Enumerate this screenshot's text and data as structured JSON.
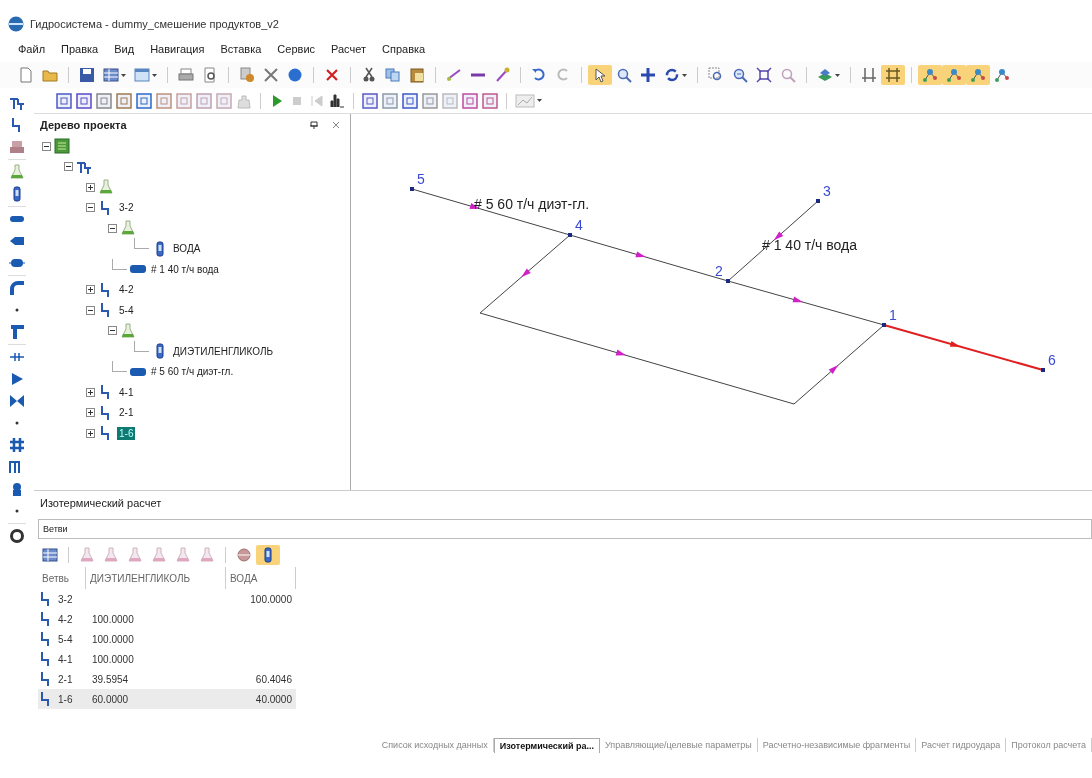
{
  "window": {
    "title": "Гидросистема - dummy_смешение продуктов_v2"
  },
  "menu": [
    "Файл",
    "Правка",
    "Вид",
    "Навигация",
    "Вставка",
    "Сервис",
    "Расчет",
    "Справка"
  ],
  "main_toolbar": [
    {
      "on": false
    },
    {
      "on": false
    },
    {
      "on": false
    },
    {
      "on": false
    },
    {
      "on": false
    },
    {
      "on": false
    },
    {
      "on": false
    },
    {
      "on": false
    },
    {
      "on": false
    },
    {
      "on": false
    },
    {
      "on": false
    },
    {
      "on": false
    },
    {
      "on": false
    },
    {
      "on": false
    },
    {
      "on": false
    },
    {
      "on": false
    },
    {
      "on": false
    },
    {
      "on": false
    },
    {
      "on": false
    },
    {
      "on": true
    },
    {
      "on": false
    },
    {
      "on": false
    },
    {
      "on": false
    },
    {
      "on": false
    },
    {
      "on": false
    },
    {
      "on": false
    },
    {
      "on": false
    },
    {
      "on": false
    },
    {
      "on": false
    },
    {
      "on": true
    },
    {
      "on": true
    },
    {
      "on": true
    },
    {
      "on": true
    },
    {
      "on": false
    }
  ],
  "project_tree": {
    "title": "Дерево проекта",
    "items": [
      {
        "kind": "project",
        "expanded": true,
        "selected": false,
        "children": [
          {
            "kind": "network",
            "expanded": true,
            "selected": false,
            "children": [
              {
                "kind": "flask",
                "expanded": false,
                "selected": false
              },
              {
                "kind": "branch",
                "label": "3-2",
                "expanded": true,
                "selected": false,
                "children": [
                  {
                    "kind": "flask",
                    "expanded": true,
                    "selected": false,
                    "children": [
                      {
                        "kind": "bottle",
                        "label": "ВОДА",
                        "selected": false
                      }
                    ]
                  },
                  {
                    "kind": "flow",
                    "label": "# 1 40 т/ч вода",
                    "selected": false
                  }
                ]
              },
              {
                "kind": "branch",
                "label": "4-2",
                "expanded": false,
                "selected": false
              },
              {
                "kind": "branch",
                "label": "5-4",
                "expanded": true,
                "selected": false,
                "children": [
                  {
                    "kind": "flask",
                    "expanded": true,
                    "selected": false,
                    "children": [
                      {
                        "kind": "bottle",
                        "label": "ДИЭТИЛЕНГЛИКОЛЬ",
                        "selected": false
                      }
                    ]
                  },
                  {
                    "kind": "flow",
                    "label": "# 5 60 т/ч диэт-гл.",
                    "selected": false
                  }
                ]
              },
              {
                "kind": "branch",
                "label": "4-1",
                "expanded": false,
                "selected": false
              },
              {
                "kind": "branch",
                "label": "2-1",
                "expanded": false,
                "selected": false
              },
              {
                "kind": "branch",
                "label": "1-6",
                "expanded": false,
                "selected": true
              }
            ]
          }
        ]
      }
    ]
  },
  "diagram": {
    "nodes": [
      "5",
      "4",
      "2",
      "1",
      "6",
      "3"
    ],
    "labels": [
      "# 5 60 т/ч диэт-гл.",
      "# 1 40 т/ч вода"
    ],
    "pipes": [
      {
        "selected": false
      },
      {
        "selected": false
      },
      {
        "selected": false
      },
      {
        "selected": false
      },
      {
        "selected": false
      },
      {
        "selected": true
      }
    ]
  },
  "calc_panel": {
    "title": "Изотермический расчет",
    "view": "Ветви",
    "toolbar": [
      {
        "on": false
      },
      {
        "on": false
      },
      {
        "on": false
      },
      {
        "on": false
      },
      {
        "on": false
      },
      {
        "on": false
      },
      {
        "on": false
      },
      {
        "on": false
      },
      {
        "on": true
      }
    ],
    "columns": [
      "Ветвь",
      "ДИЭТИЛЕНГЛИКОЛЬ",
      "ВОДА"
    ],
    "rows": [
      {
        "branch": "3-2",
        "water": "100.0000",
        "selected": false
      },
      {
        "branch": "4-2",
        "glycol": "100.0000",
        "selected": false
      },
      {
        "branch": "5-4",
        "glycol": "100.0000",
        "selected": false
      },
      {
        "branch": "4-1",
        "glycol": "100.0000",
        "selected": false
      },
      {
        "branch": "2-1",
        "glycol": "39.5954",
        "water": "60.4046",
        "selected": false
      },
      {
        "branch": "1-6",
        "glycol": "60.0000",
        "water": "40.0000",
        "selected": true
      }
    ]
  },
  "bottom_tabs": [
    {
      "label": "Список исходных данных",
      "selected": false
    },
    {
      "label": "Изотермический ра...",
      "selected": true
    },
    {
      "label": "Управляющие/целевые параметры",
      "selected": false
    },
    {
      "label": "Расчетно-независимые фрагменты",
      "selected": false
    },
    {
      "label": "Расчет гидроудара",
      "selected": false
    },
    {
      "label": "Протокол расчета",
      "selected": false
    }
  ]
}
